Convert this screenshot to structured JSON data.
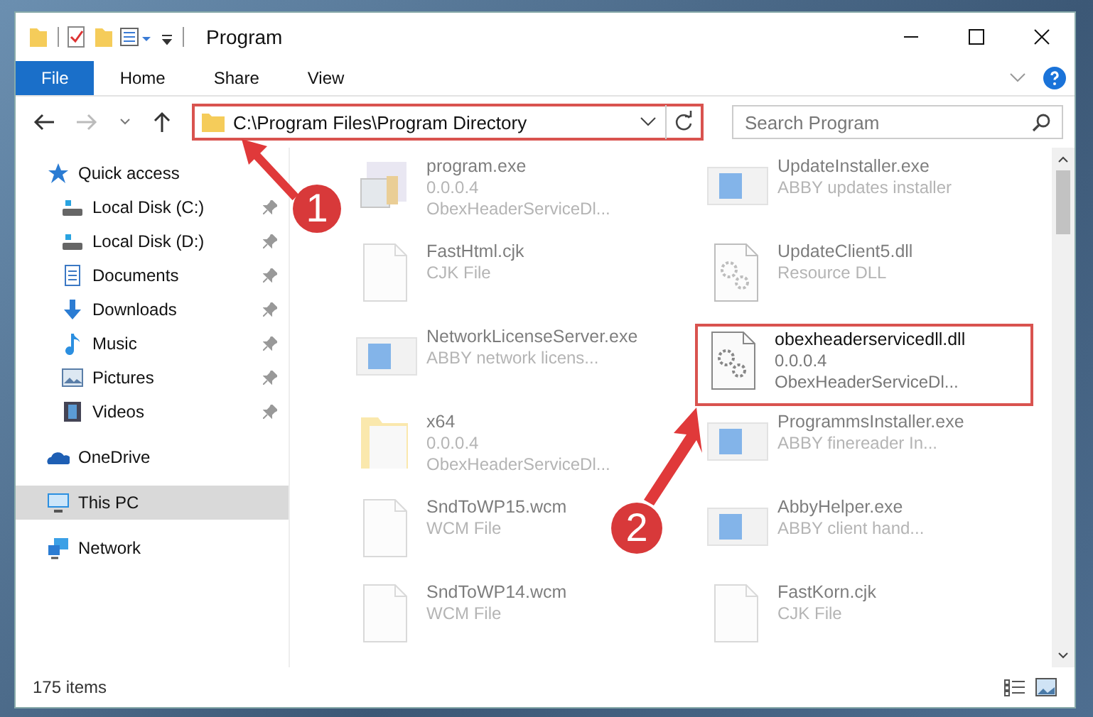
{
  "window": {
    "title": "Program"
  },
  "ribbon_tabs": [
    {
      "label": "File",
      "kind": "file"
    },
    {
      "label": "Home",
      "kind": "tab"
    },
    {
      "label": "Share",
      "kind": "tab"
    },
    {
      "label": "View",
      "kind": "tab"
    }
  ],
  "address_bar": {
    "path": "C:\\Program Files\\Program Directory",
    "highlighted": true
  },
  "search": {
    "placeholder": "Search Program"
  },
  "sidebar": {
    "items": [
      {
        "label": "Quick access",
        "kind": "star",
        "pinned": false,
        "selected": false,
        "children": [
          {
            "label": "Local Disk (C:)",
            "kind": "drive",
            "pinned": true,
            "selected": false
          },
          {
            "label": "Local Disk (D:)",
            "kind": "drive",
            "pinned": true,
            "selected": false
          },
          {
            "label": "Documents",
            "kind": "doc",
            "pinned": true,
            "selected": false
          },
          {
            "label": "Downloads",
            "kind": "download",
            "pinned": true,
            "selected": false
          },
          {
            "label": "Music",
            "kind": "music",
            "pinned": true,
            "selected": false
          },
          {
            "label": "Pictures",
            "kind": "picture",
            "pinned": true,
            "selected": false
          },
          {
            "label": "Videos",
            "kind": "video",
            "pinned": true,
            "selected": false
          }
        ]
      },
      {
        "label": "OneDrive",
        "kind": "cloud",
        "pinned": false,
        "selected": false
      },
      {
        "label": "This PC",
        "kind": "pc",
        "pinned": false,
        "selected": true
      },
      {
        "label": "Network",
        "kind": "network",
        "pinned": false,
        "selected": false
      }
    ]
  },
  "files": [
    {
      "name": "program.exe",
      "details": [
        "0.0.0.4",
        "ObexHeaderServiceDl..."
      ],
      "kind": "setup",
      "highlighted": false
    },
    {
      "name": "UpdateInstaller.exe",
      "details": [
        "ABBY updates installer"
      ],
      "kind": "app",
      "highlighted": false
    },
    {
      "name": "FastHtml.cjk",
      "details": [
        "CJK File"
      ],
      "kind": "blank",
      "highlighted": false
    },
    {
      "name": "UpdateClient5.dll",
      "details": [
        "Resource DLL"
      ],
      "kind": "dll",
      "highlighted": false
    },
    {
      "name": "NetworkLicenseServer.exe",
      "details": [
        "ABBY network licens..."
      ],
      "kind": "app",
      "highlighted": false
    },
    {
      "name": "obexheaderservicedll.dll",
      "details": [
        "0.0.0.4",
        "ObexHeaderServiceDl..."
      ],
      "kind": "dll",
      "highlighted": true
    },
    {
      "name": "x64",
      "details": [
        "0.0.0.4",
        "ObexHeaderServiceDl..."
      ],
      "kind": "folder",
      "highlighted": false
    },
    {
      "name": "ProgrammsInstaller.exe",
      "details": [
        "ABBY finereader In..."
      ],
      "kind": "app",
      "highlighted": false
    },
    {
      "name": "SndToWP15.wcm",
      "details": [
        "WCM File"
      ],
      "kind": "blank",
      "highlighted": false
    },
    {
      "name": "AbbyHelper.exe",
      "details": [
        "ABBY client hand..."
      ],
      "kind": "app",
      "highlighted": false
    },
    {
      "name": "SndToWP14.wcm",
      "details": [
        "WCM File"
      ],
      "kind": "blank",
      "highlighted": false
    },
    {
      "name": "FastKorn.cjk",
      "details": [
        "CJK File"
      ],
      "kind": "blank",
      "highlighted": false
    }
  ],
  "status_bar": {
    "item_count": "175 items"
  },
  "annotations": [
    {
      "number": "1"
    },
    {
      "number": "2"
    }
  ]
}
